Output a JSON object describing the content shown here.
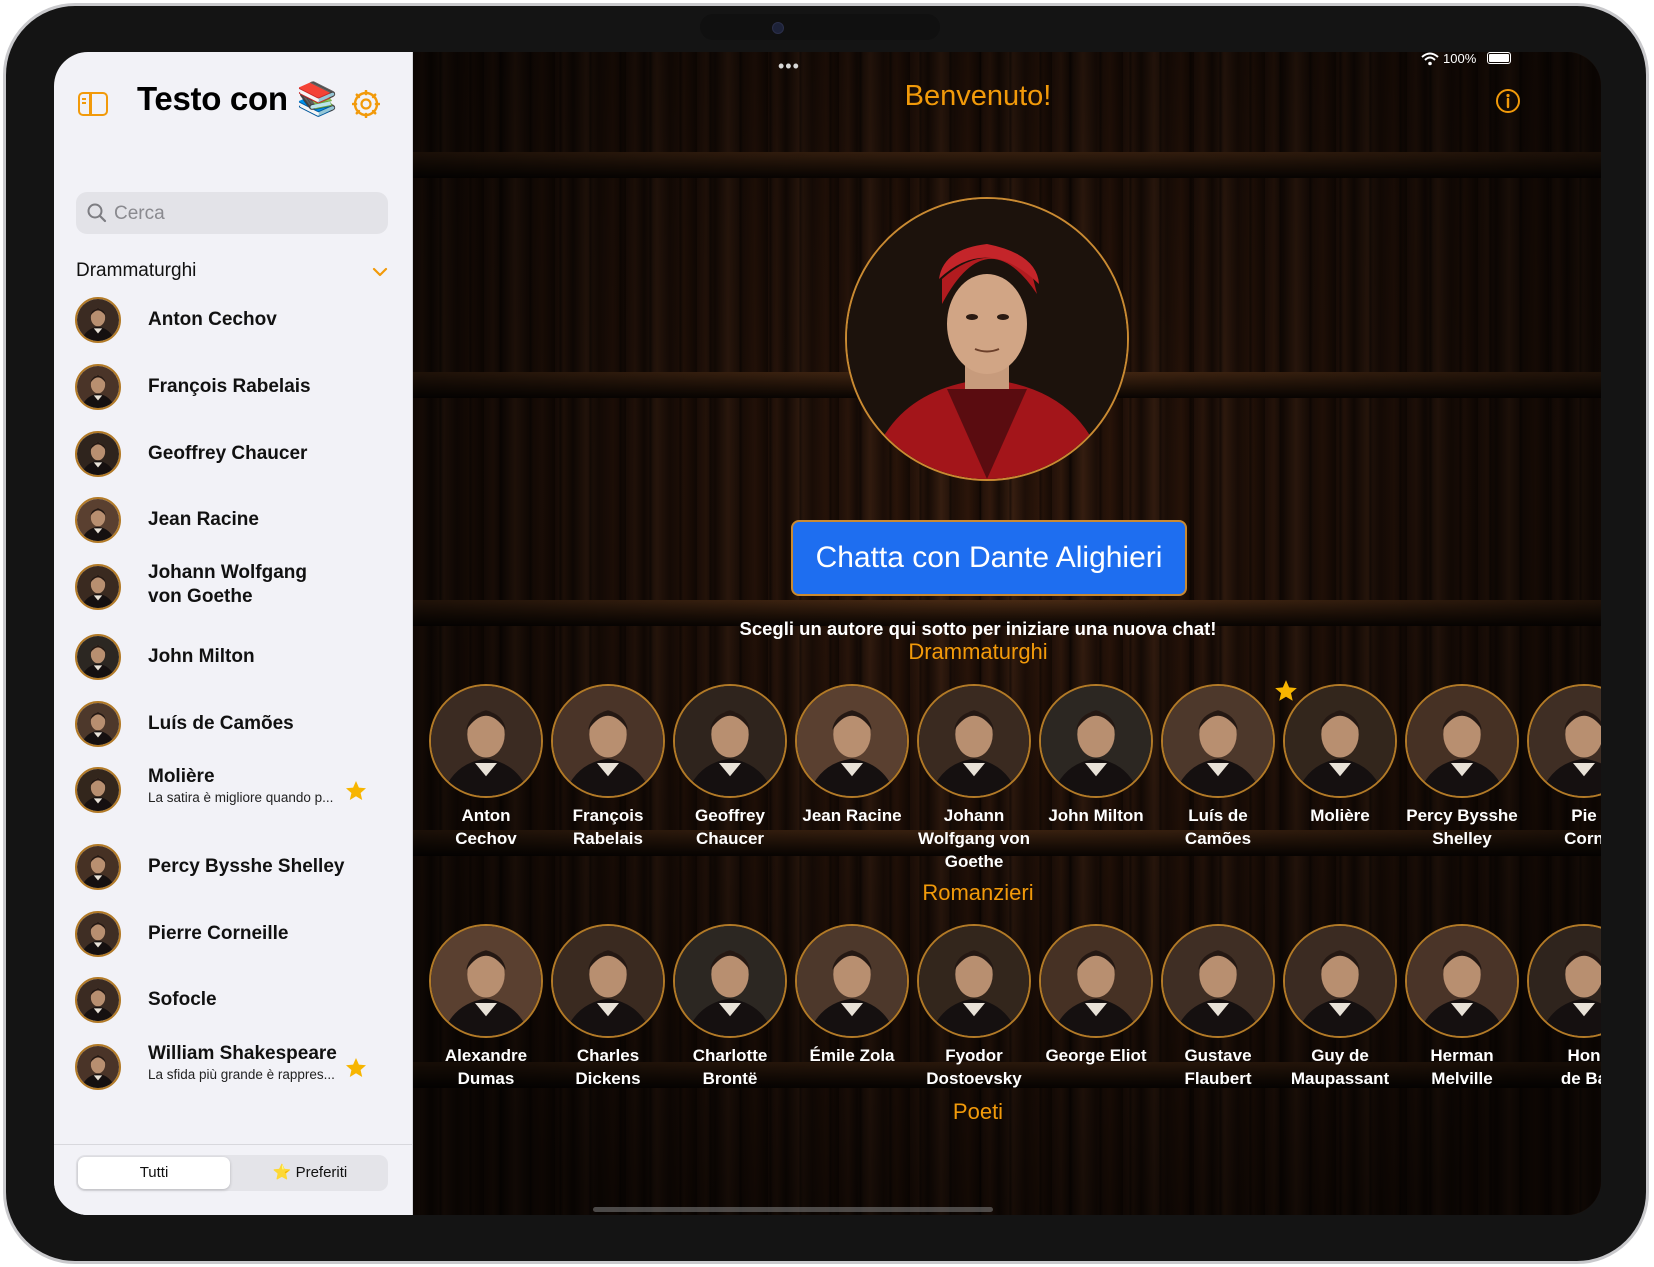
{
  "status": {
    "battery": "100%"
  },
  "sidebar": {
    "title": "Testo con 📚",
    "search_placeholder": "Cerca",
    "section": "Drammaturghi",
    "items": [
      {
        "name": "Anton Cechov",
        "subtitle": "",
        "favorite": false
      },
      {
        "name": "François Rabelais",
        "subtitle": "",
        "favorite": false
      },
      {
        "name": "Geoffrey Chaucer",
        "subtitle": "",
        "favorite": false
      },
      {
        "name": "Jean Racine",
        "subtitle": "",
        "favorite": false
      },
      {
        "name": "Johann Wolfgang\nvon Goethe",
        "subtitle": "",
        "favorite": false
      },
      {
        "name": "John Milton",
        "subtitle": "",
        "favorite": false
      },
      {
        "name": "Luís de Camões",
        "subtitle": "",
        "favorite": false
      },
      {
        "name": "Molière",
        "subtitle": "La satira è migliore quando p...",
        "favorite": true
      },
      {
        "name": "Percy Bysshe Shelley",
        "subtitle": "",
        "favorite": false
      },
      {
        "name": "Pierre Corneille",
        "subtitle": "",
        "favorite": false
      },
      {
        "name": "Sofocle",
        "subtitle": "",
        "favorite": false
      },
      {
        "name": "William Shakespeare",
        "subtitle": "La sfida più grande è rappres...",
        "favorite": true
      }
    ],
    "segments": {
      "all": "Tutti",
      "favorites": "⭐ Preferiti"
    }
  },
  "main": {
    "title": "Benvenuto!",
    "chat_button": "Chatta con Dante Alighieri",
    "hint": "Scegli un autore qui sotto per iniziare una nuova chat!",
    "categories": [
      {
        "title": "Drammaturghi",
        "authors": [
          {
            "name": "Anton\nCechov",
            "favorite": false
          },
          {
            "name": "François\nRabelais",
            "favorite": false
          },
          {
            "name": "Geoffrey\nChaucer",
            "favorite": false
          },
          {
            "name": "Jean Racine",
            "favorite": false
          },
          {
            "name": "Johann\nWolfgang von\nGoethe",
            "favorite": false
          },
          {
            "name": "John Milton",
            "favorite": false
          },
          {
            "name": "Luís de\nCamões",
            "favorite": false
          },
          {
            "name": "Molière",
            "favorite": true
          },
          {
            "name": "Percy Bysshe\nShelley",
            "favorite": false
          },
          {
            "name": "Pie\nCorn",
            "favorite": false
          }
        ]
      },
      {
        "title": "Romanzieri",
        "authors": [
          {
            "name": "Alexandre\nDumas",
            "favorite": false
          },
          {
            "name": "Charles\nDickens",
            "favorite": false
          },
          {
            "name": "Charlotte\nBrontë",
            "favorite": false
          },
          {
            "name": "Émile Zola",
            "favorite": false
          },
          {
            "name": "Fyodor\nDostoevsky",
            "favorite": false
          },
          {
            "name": "George Eliot",
            "favorite": false
          },
          {
            "name": "Gustave\nFlaubert",
            "favorite": false
          },
          {
            "name": "Guy de\nMaupassant",
            "favorite": false
          },
          {
            "name": "Herman\nMelville",
            "favorite": false
          },
          {
            "name": "Hon\nde Ba",
            "favorite": false
          }
        ]
      },
      {
        "title": "Poeti",
        "authors": []
      }
    ]
  },
  "colors": {
    "accent": "#f29a0a",
    "button": "#1e6ef0",
    "frame": "#c98a32"
  },
  "icons": {
    "sidebar_toggle": "sidebar-left-icon",
    "settings": "gear-icon",
    "search": "magnifier-icon",
    "chevron": "chevron-down-icon",
    "info": "info-circle-icon",
    "favorite": "star-icon"
  }
}
